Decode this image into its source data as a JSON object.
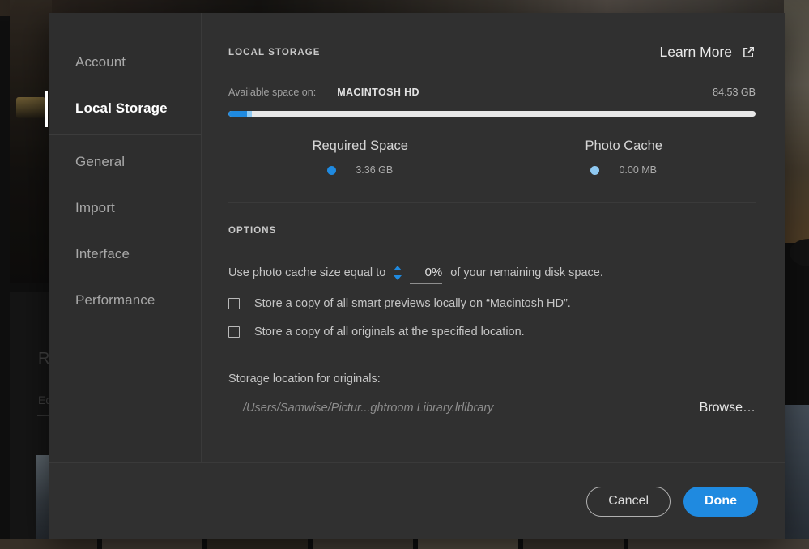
{
  "sidebar": {
    "items": [
      {
        "label": "Account",
        "active": false
      },
      {
        "label": "Local Storage",
        "active": true
      },
      {
        "label": "General",
        "active": false
      },
      {
        "label": "Import",
        "active": false
      },
      {
        "label": "Interface",
        "active": false
      },
      {
        "label": "Performance",
        "active": false
      }
    ]
  },
  "local_storage": {
    "section_title": "LOCAL STORAGE",
    "learn_more_label": "Learn More",
    "learn_more_icon": "external-link-icon",
    "available_label": "Available space on:",
    "drive_name": "MACINTOSH HD",
    "available_value": "84.53 GB",
    "bar": {
      "required_percent": 3.6,
      "cache_percent": 0.8,
      "track_color": "#e8e8e8",
      "required_color": "#1f8ae0",
      "cache_color": "#8fc9f2"
    },
    "legend": [
      {
        "title": "Required Space",
        "value": "3.36 GB",
        "color": "#1f8ae0"
      },
      {
        "title": "Photo Cache",
        "value": "0.00 MB",
        "color": "#8fc9f2"
      }
    ]
  },
  "options": {
    "section_title": "OPTIONS",
    "cache_prefix": "Use photo cache size equal to",
    "cache_value": "0%",
    "cache_suffix": "of your remaining disk space.",
    "stepper_icon": "stepper-up-down-icon",
    "checkboxes": [
      {
        "label": "Store a copy of all smart previews locally on “Macintosh HD”.",
        "checked": false
      },
      {
        "label": "Store a copy of all originals at the specified location.",
        "checked": false
      }
    ],
    "storage_location_label": "Storage location for originals:",
    "storage_path": "/Users/Samwise/Pictur...ghtroom Library.lrlibrary",
    "browse_label": "Browse…"
  },
  "footer": {
    "cancel_label": "Cancel",
    "done_label": "Done",
    "accent_color": "#1f8ae0"
  },
  "background": {
    "panel_title": "R",
    "panel_sub": "Ed"
  }
}
